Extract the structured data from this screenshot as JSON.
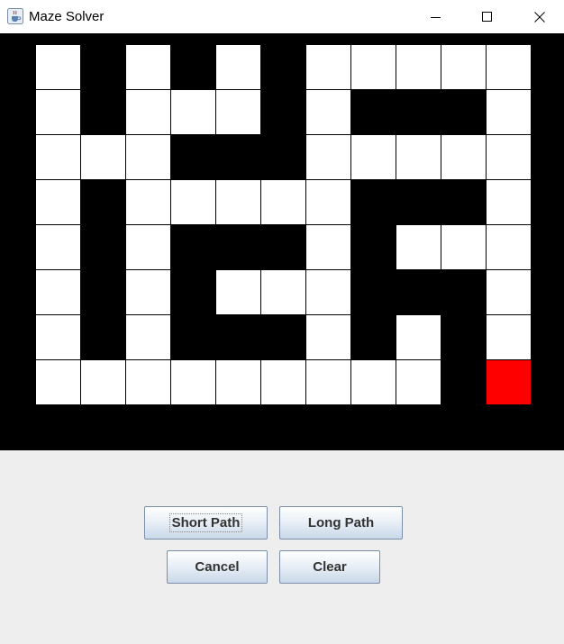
{
  "window": {
    "title": "Maze Solver",
    "icon": "java-cup-icon",
    "controls": [
      "minimize-icon",
      "maximize-icon",
      "close-icon"
    ]
  },
  "maze": {
    "rows": 8,
    "cols": 11,
    "legend": {
      "1": "open",
      "0": "wall",
      "2": "goal"
    },
    "colors": {
      "open": "#ffffff",
      "wall": "#000000",
      "goal": "#ff0000",
      "background": "#000000"
    },
    "grid": [
      [
        1,
        0,
        1,
        0,
        1,
        0,
        1,
        1,
        1,
        1,
        1
      ],
      [
        1,
        0,
        1,
        1,
        1,
        0,
        1,
        0,
        0,
        0,
        1
      ],
      [
        1,
        1,
        1,
        0,
        0,
        0,
        1,
        1,
        1,
        1,
        1
      ],
      [
        1,
        0,
        1,
        1,
        1,
        1,
        1,
        0,
        0,
        0,
        1
      ],
      [
        1,
        0,
        1,
        0,
        0,
        0,
        1,
        0,
        1,
        1,
        1
      ],
      [
        1,
        0,
        1,
        0,
        1,
        1,
        1,
        0,
        0,
        0,
        1
      ],
      [
        1,
        0,
        1,
        0,
        0,
        0,
        1,
        0,
        1,
        0,
        1
      ],
      [
        1,
        1,
        1,
        1,
        1,
        1,
        1,
        1,
        1,
        0,
        2
      ]
    ]
  },
  "buttons": {
    "short_path": "Short Path",
    "long_path": "Long Path",
    "cancel": "Cancel",
    "clear": "Clear"
  }
}
